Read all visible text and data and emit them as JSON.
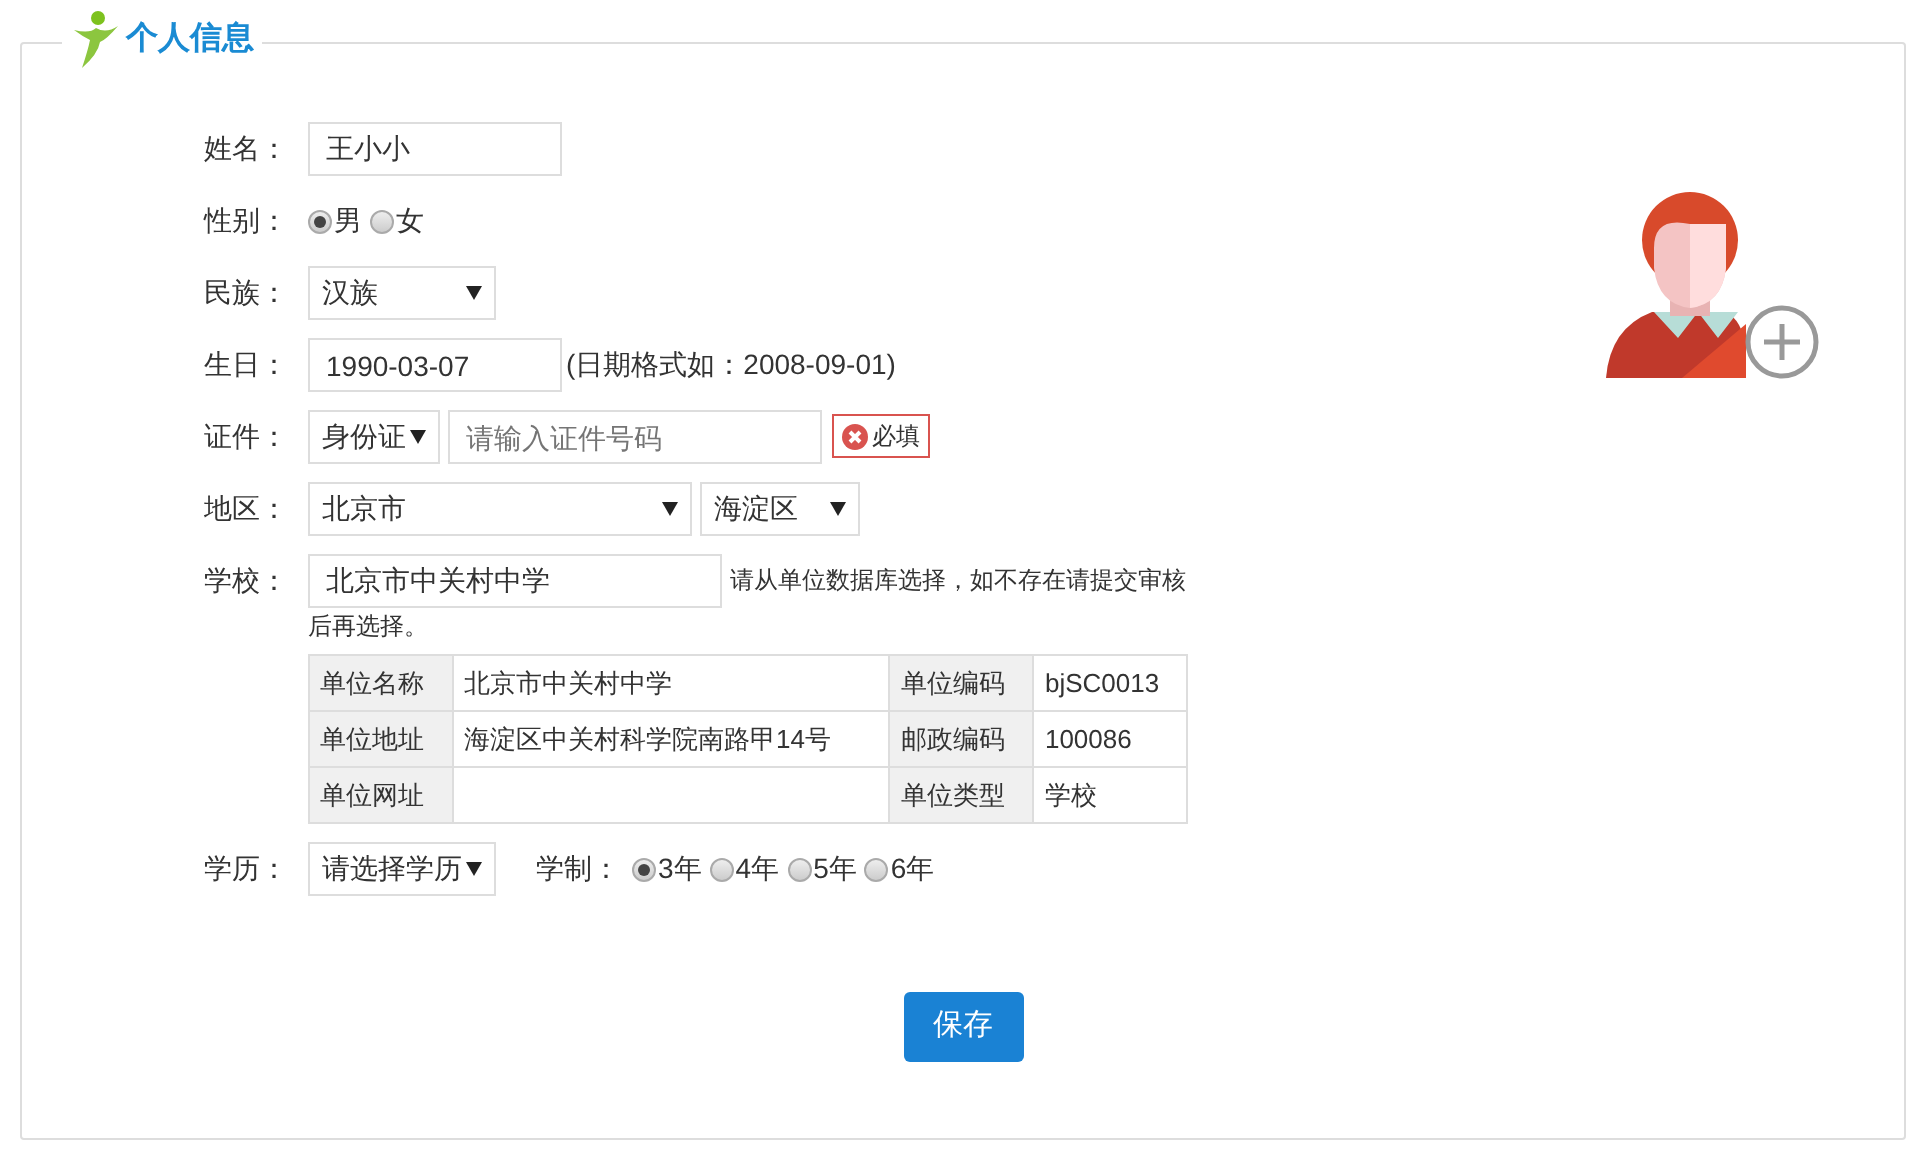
{
  "title": "个人信息",
  "fields": [
    {
      "kind": "text",
      "label": "姓名：",
      "value": "王小小"
    },
    {
      "kind": "radio",
      "label": "性别：",
      "options": [
        {
          "text": "男",
          "selected": true
        },
        {
          "text": "女",
          "selected": false
        }
      ]
    },
    {
      "kind": "select",
      "label": "民族：",
      "value": "汉族"
    },
    {
      "kind": "date",
      "label": "生日：",
      "value": "1990-03-07",
      "hint": "(日期格式如：2008-09-01)"
    },
    {
      "kind": "id",
      "label": "证件：",
      "type": "身份证",
      "placeholder": "请输入证件号码",
      "error": "必填"
    },
    {
      "kind": "region",
      "label": "地区：",
      "city": "北京市",
      "district": "海淀区"
    },
    {
      "kind": "school",
      "label": "学校：",
      "value": "北京市中关村中学",
      "hint_lines": [
        "请从单位数据库选择，如不存在请提交审核",
        "后再选择。"
      ],
      "details": [
        [
          {
            "label": "单位名称",
            "value": "北京市中关村中学"
          },
          {
            "label": "单位编码",
            "value": "bjSC0013"
          }
        ],
        [
          {
            "label": "单位地址",
            "value": "海淀区中关村科学院南路甲14号"
          },
          {
            "label": "邮政编码",
            "value": "100086"
          }
        ],
        [
          {
            "label": "单位网址"
          },
          {
            "label": "单位类型",
            "value": "学校"
          }
        ]
      ]
    },
    {
      "kind": "education",
      "label": "学历：",
      "value": "请选择学历",
      "length_label": "学制：",
      "options": [
        {
          "text": "3年",
          "selected": true
        },
        {
          "text": "4年",
          "selected": false
        },
        {
          "text": "5年",
          "selected": false
        },
        {
          "text": "6年",
          "selected": false
        }
      ]
    }
  ],
  "save_button": "保存"
}
